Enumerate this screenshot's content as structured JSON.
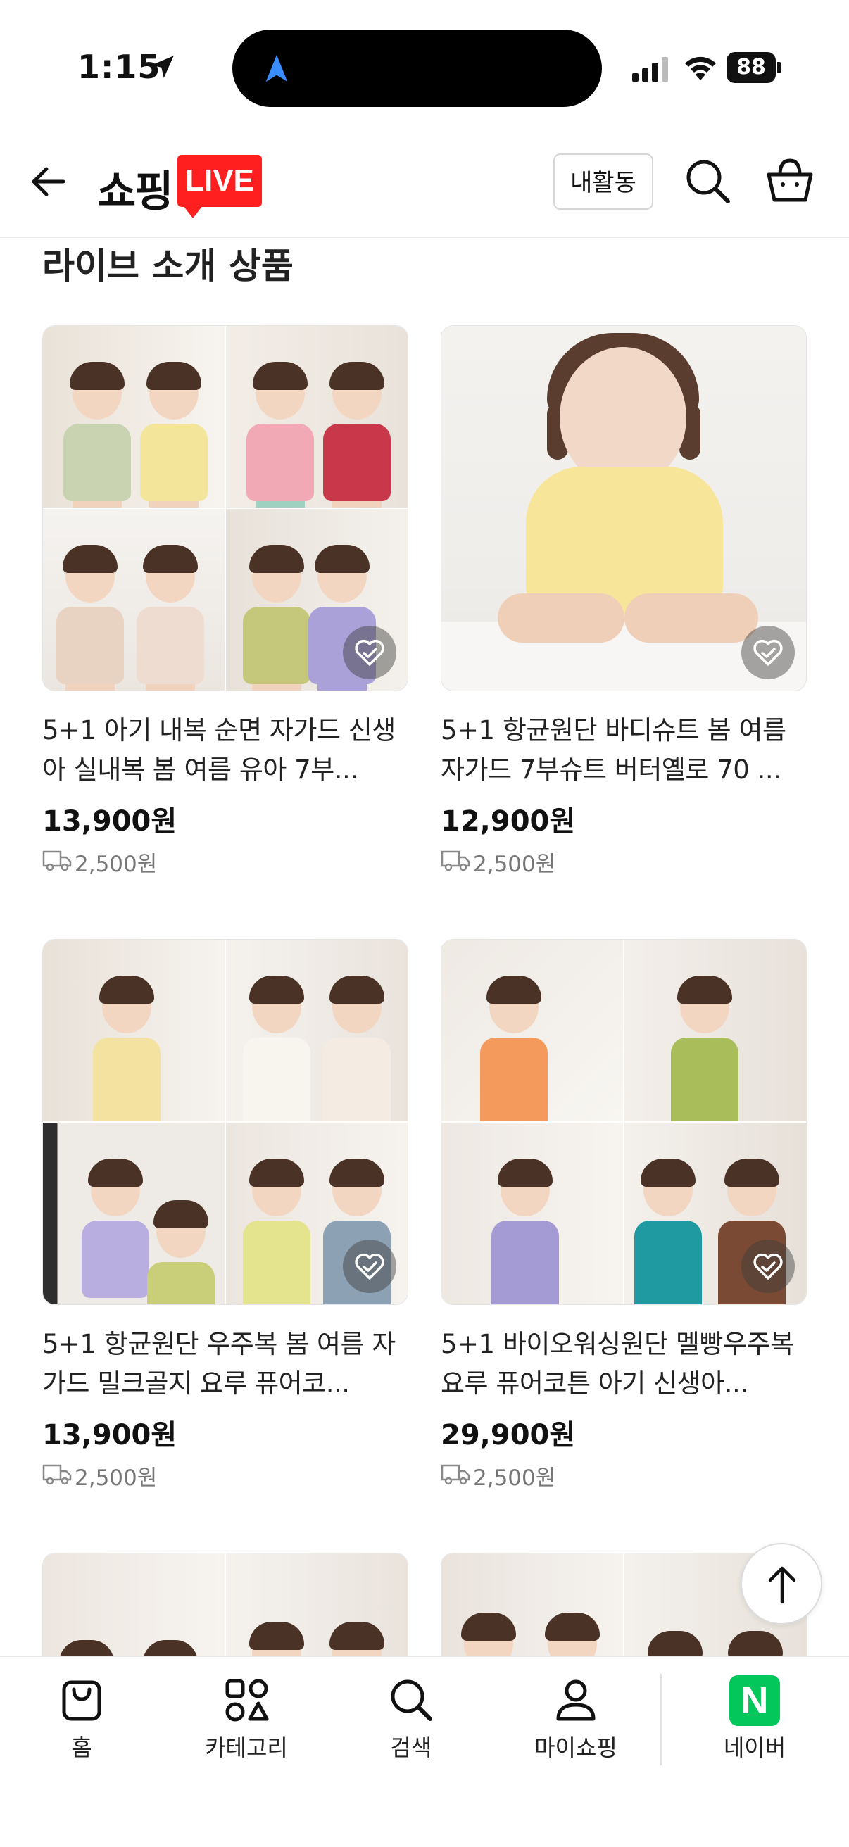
{
  "status_bar": {
    "time": "1:15",
    "battery": "88"
  },
  "header": {
    "logo_text": "쇼핑",
    "live_badge": "LIVE",
    "my_activity": "내활동"
  },
  "section": {
    "title": "라이브 소개 상품"
  },
  "products": [
    {
      "title": "5+1 아기 내복 순면 자가드 신생아 실내복 봄 여름 유아 7부...",
      "price": "13,900원",
      "shipping": "2,500원"
    },
    {
      "title": "5+1 항균원단 바디슈트 봄 여름 자가드 7부슈트 버터옐로 70 ...",
      "price": "12,900원",
      "shipping": "2,500원"
    },
    {
      "title": "5+1 항균원단 우주복 봄 여름 자가드 밀크골지 요루 퓨어코...",
      "price": "13,900원",
      "shipping": "2,500원"
    },
    {
      "title": "5+1 바이오워싱원단 멜빵우주복 요루 퓨어코튼 아기 신생아...",
      "price": "29,900원",
      "shipping": "2,500원"
    }
  ],
  "tabbar": {
    "home": "홈",
    "category": "카테고리",
    "search": "검색",
    "myshopping": "마이쇼핑",
    "naver": "네이버",
    "naver_logo": "N"
  },
  "colors": {
    "live_red": "#ff1f1f",
    "naver_green": "#03c75a"
  },
  "icons": [
    "back-arrow-icon",
    "search-icon",
    "cart-icon",
    "heart-check-icon",
    "truck-icon",
    "arrow-up-icon",
    "home-bag-icon",
    "category-icon",
    "person-icon",
    "location-arrow-icon"
  ]
}
